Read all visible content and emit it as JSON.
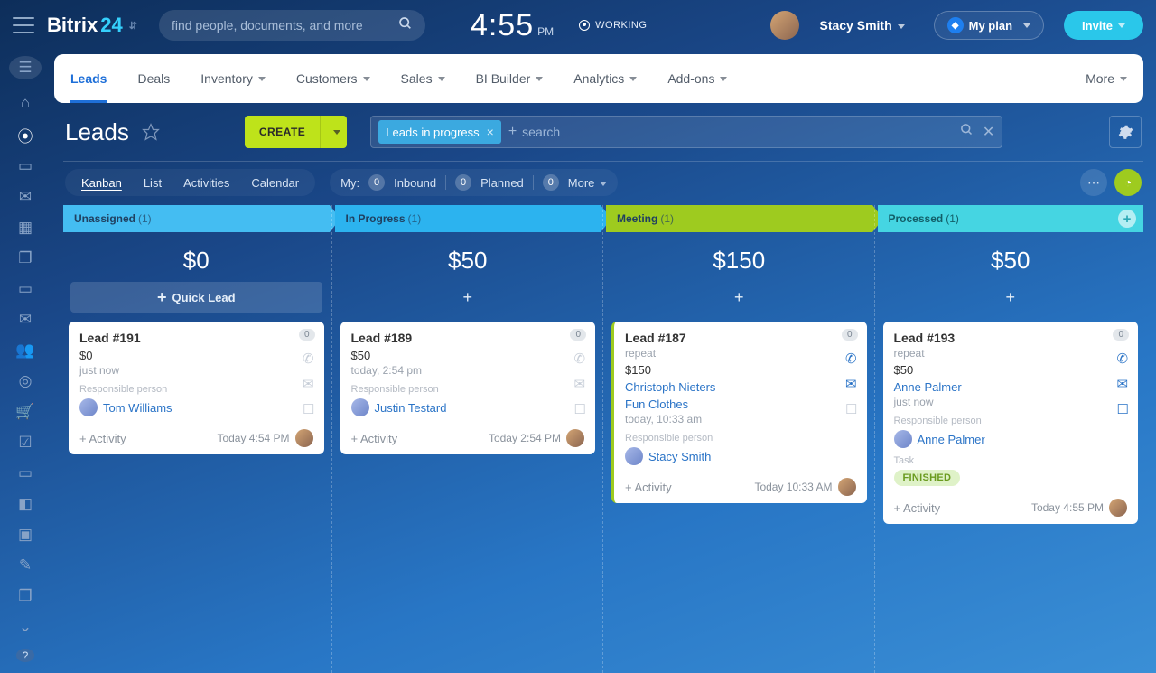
{
  "brand": {
    "name": "Bitrix",
    "num": "24"
  },
  "search": {
    "placeholder": "find people, documents, and more"
  },
  "clock": {
    "time": "4:55",
    "pm": "PM",
    "status": "WORKING"
  },
  "user": {
    "name": "Stacy Smith"
  },
  "plan": {
    "label": "My plan"
  },
  "invite": {
    "label": "Invite"
  },
  "tabs": {
    "items": [
      "Leads",
      "Deals",
      "Inventory",
      "Customers",
      "Sales",
      "BI Builder",
      "Analytics",
      "Add-ons"
    ],
    "more": "More"
  },
  "page": {
    "title": "Leads",
    "create": "CREATE",
    "filter_chip": "Leads in progress",
    "filter_placeholder": "search"
  },
  "views": {
    "items": [
      "Kanban",
      "List",
      "Activities",
      "Calendar"
    ],
    "my": "My:",
    "inbound": {
      "count": "0",
      "label": "Inbound"
    },
    "planned": {
      "count": "0",
      "label": "Planned"
    },
    "more": {
      "count": "0",
      "label": "More"
    }
  },
  "columns": [
    {
      "title": "Unassigned",
      "count": "(1)",
      "sum": "$0",
      "quick": "Quick Lead"
    },
    {
      "title": "In Progress",
      "count": "(1)",
      "sum": "$50"
    },
    {
      "title": "Meeting",
      "count": "(1)",
      "sum": "$150"
    },
    {
      "title": "Processed",
      "count": "(1)",
      "sum": "$50"
    }
  ],
  "cards": {
    "c0": {
      "title": "Lead #191",
      "badge": "0",
      "amount": "$0",
      "time": "just now",
      "resp": "Responsible person",
      "person": "Tom Williams",
      "activity": "+ Activity",
      "footer_time": "Today 4:54 PM"
    },
    "c1": {
      "title": "Lead #189",
      "badge": "0",
      "amount": "$50",
      "time": "today, 2:54 pm",
      "resp": "Responsible person",
      "person": "Justin Testard",
      "activity": "+ Activity",
      "footer_time": "Today 2:54 PM"
    },
    "c2": {
      "title": "Lead #187",
      "badge": "0",
      "sub": "repeat",
      "amount": "$150",
      "link1": "Christoph Nieters",
      "link2": "Fun Clothes",
      "time": "today, 10:33 am",
      "resp": "Responsible person",
      "person": "Stacy Smith",
      "activity": "+ Activity",
      "footer_time": "Today 10:33 AM"
    },
    "c3": {
      "title": "Lead #193",
      "badge": "0",
      "sub": "repeat",
      "amount": "$50",
      "link1": "Anne Palmer",
      "time": "just now",
      "resp": "Responsible person",
      "person": "Anne Palmer",
      "task_label": "Task",
      "tag": "FINISHED",
      "activity": "+ Activity",
      "footer_time": "Today 4:55 PM"
    }
  }
}
